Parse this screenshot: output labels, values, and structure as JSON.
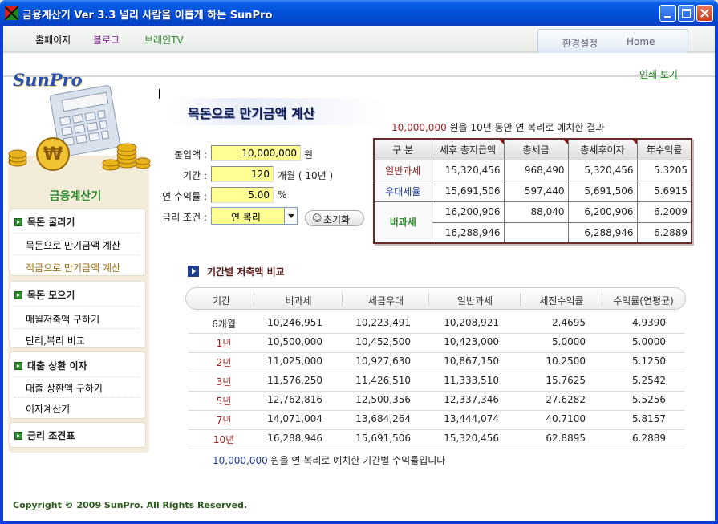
{
  "window": {
    "title": "금융계산기 Ver 3.3  널리 사람을 이롭게 하는 SunPro",
    "titlebar_color": "#0351d8"
  },
  "topnav": {
    "links": [
      "홈페이지",
      "블로그",
      "브레인TV"
    ],
    "link_colors": [
      "#333333",
      "#7a1a8a",
      "#2f8a2f"
    ],
    "settings_label": "환경설정",
    "home_label": "Home"
  },
  "print_label": "인쇄 보기",
  "logo_text": "SunPro",
  "sidebar": {
    "title": "금융계산기",
    "sections": [
      {
        "header": "목돈 굴리기",
        "items": [
          "목돈으로 만기금액 계산",
          "적금으로 만기금액 계산"
        ]
      },
      {
        "header": "목돈 모으기",
        "items": [
          "매월저축액 구하기",
          "단리,복리 비교"
        ]
      },
      {
        "header": "대출 상환 이자",
        "items": [
          "대출 상환액 구하기",
          "이자계산기"
        ]
      },
      {
        "header": "금리 조견표",
        "items": []
      }
    ],
    "accent": "#2f8a2f"
  },
  "copyright": "Copyright  ©  2009  SunPro.  All  Rights  Reserved.",
  "main": {
    "title": "목돈으로 만기금액 계산",
    "result_caption_amount": "10,000,000",
    "result_caption_text": " 원을 10년 동안 연 복리로 예치한 결과",
    "form": {
      "deposit_label": "불입액 :",
      "deposit_value": "10,000,000",
      "deposit_unit": "원",
      "period_label": "기간 :",
      "period_value": "120",
      "period_unit": "개월  ( 10년 )",
      "rate_label": "연 수익률 :",
      "rate_value": "5.00",
      "rate_unit": "%",
      "condition_label": "금리 조건 :",
      "condition_value": "연 복리",
      "reset_label": "초기화"
    },
    "result_table": {
      "headers": [
        "구    분",
        "세후 총지급액",
        "총세금",
        "총세후이자",
        "年수익률"
      ],
      "rows": [
        {
          "label": "일반과세",
          "values": [
            "15,320,456",
            "968,490",
            "5,320,456",
            "5.3205"
          ]
        },
        {
          "label": "우대세율",
          "values": [
            "15,691,506",
            "597,440",
            "5,691,506",
            "5.6915"
          ]
        },
        {
          "label": "비과세",
          "values": [
            "16,200,906",
            "88,040",
            "6,200,906",
            "6.2009"
          ]
        },
        {
          "label": "",
          "values": [
            "16,288,946",
            "",
            "6,288,946",
            "6.2889"
          ]
        }
      ]
    },
    "compare": {
      "title": "기간별 저축액 비교",
      "headers": [
        "기간",
        "비과세",
        "세금우대",
        "일반과세",
        "세전수익률",
        "수익률(연평균)"
      ],
      "rows": [
        [
          "6개월",
          "10,246,951",
          "10,223,491",
          "10,208,921",
          "2.4695",
          "4.9390"
        ],
        [
          "1년",
          "10,500,000",
          "10,452,500",
          "10,423,000",
          "5.0000",
          "5.0000"
        ],
        [
          "2년",
          "11,025,000",
          "10,927,630",
          "10,867,150",
          "10.2500",
          "5.1250"
        ],
        [
          "3년",
          "11,576,250",
          "11,426,510",
          "11,333,510",
          "15.7625",
          "5.2542"
        ],
        [
          "5년",
          "12,762,816",
          "12,500,356",
          "12,337,346",
          "27.6282",
          "5.5256"
        ],
        [
          "7년",
          "14,071,004",
          "13,684,264",
          "13,444,074",
          "40.7100",
          "5.8157"
        ],
        [
          "10년",
          "16,288,946",
          "15,691,506",
          "15,320,456",
          "62.8895",
          "6.2889"
        ]
      ],
      "period_colors": [
        "#222222",
        "#a02020",
        "#a02020",
        "#a02020",
        "#a02020",
        "#a02020",
        "#a02020"
      ],
      "footer_amount": "10,000,000",
      "footer_text": " 원을 연 복리로 예치한 기간별 수익률입니다"
    }
  }
}
